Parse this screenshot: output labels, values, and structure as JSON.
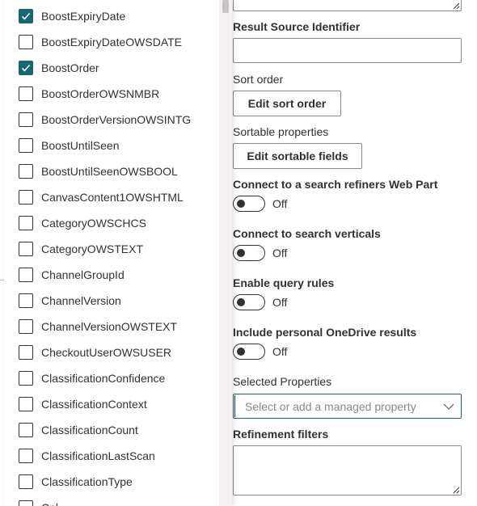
{
  "checklist": {
    "items": [
      {
        "label": "BoostExpiryDate",
        "checked": true
      },
      {
        "label": "BoostExpiryDateOWSDATE",
        "checked": false
      },
      {
        "label": "BoostOrder",
        "checked": true
      },
      {
        "label": "BoostOrderOWSNMBR",
        "checked": false
      },
      {
        "label": "BoostOrderVersionOWSINTG",
        "checked": false
      },
      {
        "label": "BoostUntilSeen",
        "checked": false
      },
      {
        "label": "BoostUntilSeenOWSBOOL",
        "checked": false
      },
      {
        "label": "CanvasContent1OWSHTML",
        "checked": false
      },
      {
        "label": "CategoryOWSCHCS",
        "checked": false
      },
      {
        "label": "CategoryOWSTEXT",
        "checked": false
      },
      {
        "label": "ChannelGroupId",
        "checked": false
      },
      {
        "label": "ChannelVersion",
        "checked": false
      },
      {
        "label": "ChannelVersionOWSTEXT",
        "checked": false
      },
      {
        "label": "CheckoutUserOWSUSER",
        "checked": false
      },
      {
        "label": "ClassificationConfidence",
        "checked": false
      },
      {
        "label": "ClassificationContext",
        "checked": false
      },
      {
        "label": "ClassificationCount",
        "checked": false
      },
      {
        "label": "ClassificationLastScan",
        "checked": false
      },
      {
        "label": "ClassificationType",
        "checked": false
      },
      {
        "label": "Col...",
        "checked": false
      }
    ]
  },
  "pane": {
    "result_source_label": "Result Source Identifier",
    "result_source_value": "",
    "sort_order_label": "Sort order",
    "edit_sort_order_button": "Edit sort order",
    "sortable_properties_label": "Sortable properties",
    "edit_sortable_fields_button": "Edit sortable fields",
    "toggles": [
      {
        "label": "Connect to a search refiners Web Part",
        "state": "Off"
      },
      {
        "label": "Connect to search verticals",
        "state": "Off"
      },
      {
        "label": "Enable query rules",
        "state": "Off"
      },
      {
        "label": "Include personal OneDrive results",
        "state": "Off"
      }
    ],
    "selected_properties_label": "Selected Properties",
    "selected_properties_placeholder": "Select or add a managed property",
    "refinement_filters_label": "Refinement filters",
    "refinement_filters_value": ""
  },
  "colors": {
    "accent": "#0f6a73",
    "text": "#323130",
    "border": "#8a8886"
  },
  "icons": {
    "checkmark": "checkmark-icon",
    "chevron": "chevron-down-icon",
    "resize": "resize-grip-icon"
  }
}
